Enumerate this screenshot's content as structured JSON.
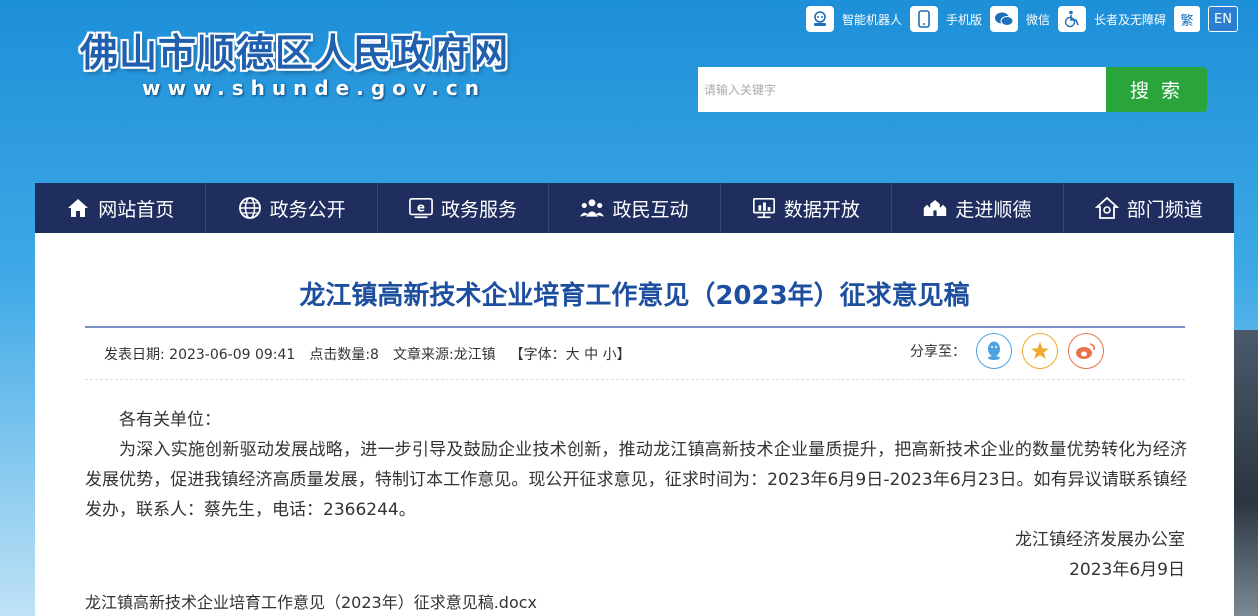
{
  "header": {
    "site_title": "佛山市顺德区人民政府网",
    "site_url": "www.shunde.gov.cn"
  },
  "toplinks": {
    "robot": "智能机器人",
    "mobile": "手机版",
    "wechat": "微信",
    "accessible": "长者及无障碍",
    "traditional": "繁",
    "english": "EN"
  },
  "search": {
    "placeholder": "请输入关键字",
    "button": "搜 索"
  },
  "nav": {
    "items": [
      {
        "label": "网站首页",
        "icon": "home-icon"
      },
      {
        "label": "政务公开",
        "icon": "globe-icon"
      },
      {
        "label": "政务服务",
        "icon": "ie-icon"
      },
      {
        "label": "政民互动",
        "icon": "people-icon"
      },
      {
        "label": "数据开放",
        "icon": "data-icon"
      },
      {
        "label": "走进顺德",
        "icon": "building-icon"
      },
      {
        "label": "部门频道",
        "icon": "house-icon"
      }
    ]
  },
  "article": {
    "title": "龙江镇高新技术企业培育工作意见（2023年）征求意见稿",
    "meta": {
      "date": "发表日期: 2023-06-09 09:41",
      "clicks": "点击数量:8",
      "source": "文章来源:龙江镇",
      "font_size": "【字体：大 中 小】"
    },
    "share_label": "分享至：",
    "salutation": "各有关单位：",
    "paragraph": "为深入实施创新驱动发展战略，进一步引导及鼓励企业技术创新，推动龙江镇高新技术企业量质提升，把高新技术企业的数量优势转化为经济发展优势，促进我镇经济高质量发展，特制订本工作意见。现公开征求意见，征求时间为：2023年6月9日-2023年6月23日。如有异议请联系镇经发办，联系人：蔡先生，电话：2366244。",
    "signature": "龙江镇经济发展办公室",
    "sign_date": "2023年6月9日",
    "attachment": "龙江镇高新技术企业培育工作意见（2023年）征求意见稿.docx"
  },
  "colors": {
    "nav_bg": "#1f2e5e",
    "search_button": "#2aa53c",
    "title": "#1d4f9e"
  }
}
